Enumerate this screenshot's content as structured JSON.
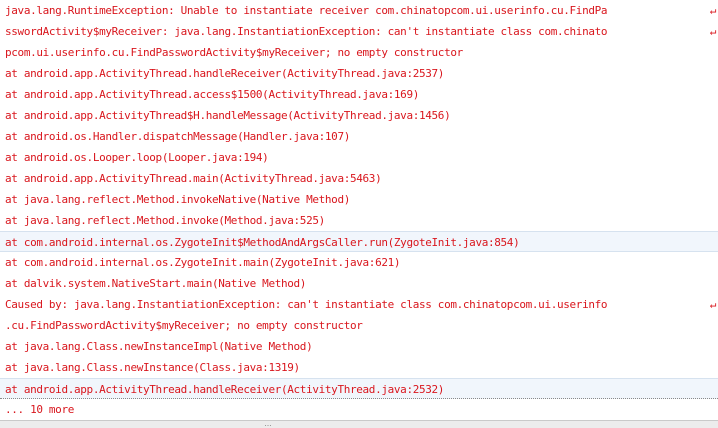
{
  "log": {
    "lines": [
      {
        "text": "java.lang.RuntimeException: Unable to instantiate receiver com.chinatopcom.ui.userinfo.cu.FindPa",
        "wrap": "↵",
        "state": "normal"
      },
      {
        "text": "sswordActivity$myReceiver: java.lang.InstantiationException: can't instantiate class com.chinato",
        "wrap": "↵",
        "state": "normal"
      },
      {
        "text": "pcom.ui.userinfo.cu.FindPasswordActivity$myReceiver; no empty constructor",
        "wrap": "",
        "state": "normal"
      },
      {
        "text": "at android.app.ActivityThread.handleReceiver(ActivityThread.java:2537)",
        "wrap": "",
        "state": "normal"
      },
      {
        "text": "at android.app.ActivityThread.access$1500(ActivityThread.java:169)",
        "wrap": "",
        "state": "normal"
      },
      {
        "text": "at android.app.ActivityThread$H.handleMessage(ActivityThread.java:1456)",
        "wrap": "",
        "state": "normal"
      },
      {
        "text": "at android.os.Handler.dispatchMessage(Handler.java:107)",
        "wrap": "",
        "state": "normal"
      },
      {
        "text": "at android.os.Looper.loop(Looper.java:194)",
        "wrap": "",
        "state": "normal"
      },
      {
        "text": "at android.app.ActivityThread.main(ActivityThread.java:5463)",
        "wrap": "",
        "state": "normal"
      },
      {
        "text": "at java.lang.reflect.Method.invokeNative(Native Method)",
        "wrap": "",
        "state": "normal"
      },
      {
        "text": "at java.lang.reflect.Method.invoke(Method.java:525)",
        "wrap": "",
        "state": "normal"
      },
      {
        "text": "at com.android.internal.os.ZygoteInit$MethodAndArgsCaller.run(ZygoteInit.java:854)",
        "wrap": "",
        "state": "highlight"
      },
      {
        "text": "at com.android.internal.os.ZygoteInit.main(ZygoteInit.java:621)",
        "wrap": "",
        "state": "normal"
      },
      {
        "text": "at dalvik.system.NativeStart.main(Native Method)",
        "wrap": "",
        "state": "normal"
      },
      {
        "text": "Caused by: java.lang.InstantiationException: can't instantiate class com.chinatopcom.ui.userinfo",
        "wrap": "↵",
        "state": "normal"
      },
      {
        "text": ".cu.FindPasswordActivity$myReceiver; no empty constructor",
        "wrap": "",
        "state": "normal"
      },
      {
        "text": "at java.lang.Class.newInstanceImpl(Native Method)",
        "wrap": "",
        "state": "normal"
      },
      {
        "text": "at java.lang.Class.newInstance(Class.java:1319)",
        "wrap": "",
        "state": "normal"
      },
      {
        "text": "at android.app.ActivityThread.handleReceiver(ActivityThread.java:2532)",
        "wrap": "",
        "state": "selected"
      },
      {
        "text": "... 10 more",
        "wrap": "",
        "state": "normal"
      }
    ]
  },
  "bottom_bar": {
    "grip": "…"
  },
  "colors": {
    "log_text": "#d9161d",
    "highlight_bg": "#f1f6fc"
  }
}
